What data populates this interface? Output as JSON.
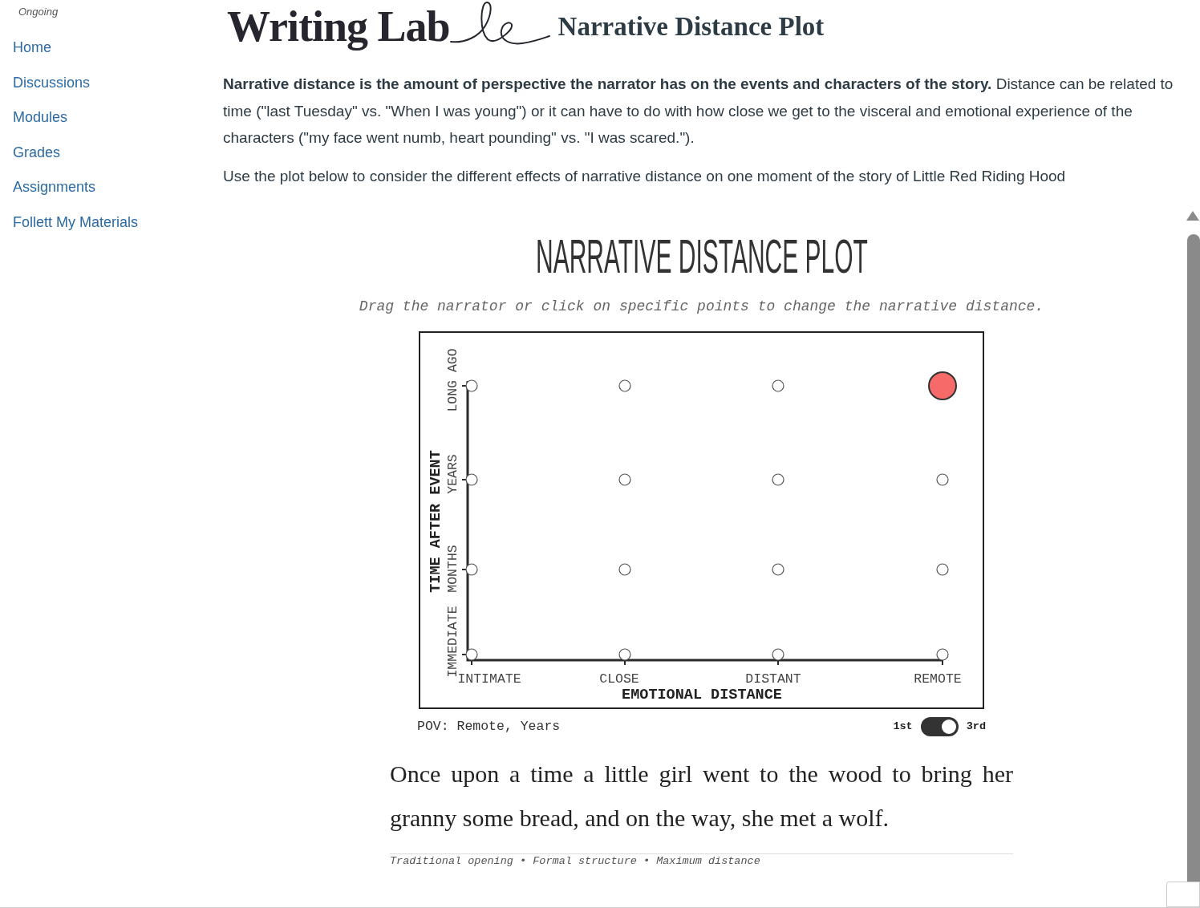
{
  "sidebar": {
    "status": "Ongoing",
    "items": [
      "Home",
      "Discussions",
      "Modules",
      "Grades",
      "Assignments",
      "Follett My Materials"
    ]
  },
  "header": {
    "title": "Writing Lab",
    "subtitle": "Narrative Distance Plot"
  },
  "intro": {
    "paragraphs": [
      "**Narrative distance is the amount of perspective the narrator has on the events and characters of the story.** Distance can be related to time (\"last Tuesday\" vs. \"When I was young\") or it can have to do with how close we get to the visceral and emotional experience of the characters (\"my face went numb, heart pounding\" vs. \"I was scared.\").",
      "Use the plot below to consider the different effects of narrative distance on one moment of the story of Little Red Riding Hood"
    ]
  },
  "plot": {
    "title": "NARRATIVE DISTANCE PLOT",
    "instruction": "Drag the narrator or click on specific points to change the narrative distance.",
    "y_axis": {
      "title": "TIME AFTER EVENT",
      "labels": [
        "LONG AGO",
        "YEARS",
        "MONTHS",
        "IMMEDIATE"
      ]
    },
    "x_axis": {
      "title": "EMOTIONAL DISTANCE",
      "labels": [
        "INTIMATE",
        "CLOSE",
        "DISTANT",
        "REMOTE"
      ]
    },
    "points": [
      {
        "selected": false
      },
      {
        "selected": false
      },
      {
        "selected": false
      },
      {
        "selected": true
      },
      {
        "selected": false
      },
      {
        "selected": false
      },
      {
        "selected": false
      },
      {
        "selected": false
      },
      {
        "selected": false
      },
      {
        "selected": false
      },
      {
        "selected": false
      },
      {
        "selected": false
      },
      {
        "selected": false
      },
      {
        "selected": false
      },
      {
        "selected": false
      },
      {
        "selected": false
      }
    ],
    "pov": "POV: Remote, Years",
    "perspective": {
      "left_label": "1st",
      "right_label": "3rd",
      "on": true
    }
  },
  "story": {
    "text": "Once upon a time a little girl went to the wood to bring her granny some bread, and on the way, she met a wolf.",
    "caption": "Traditional opening • Formal structure • Maximum distance"
  }
}
